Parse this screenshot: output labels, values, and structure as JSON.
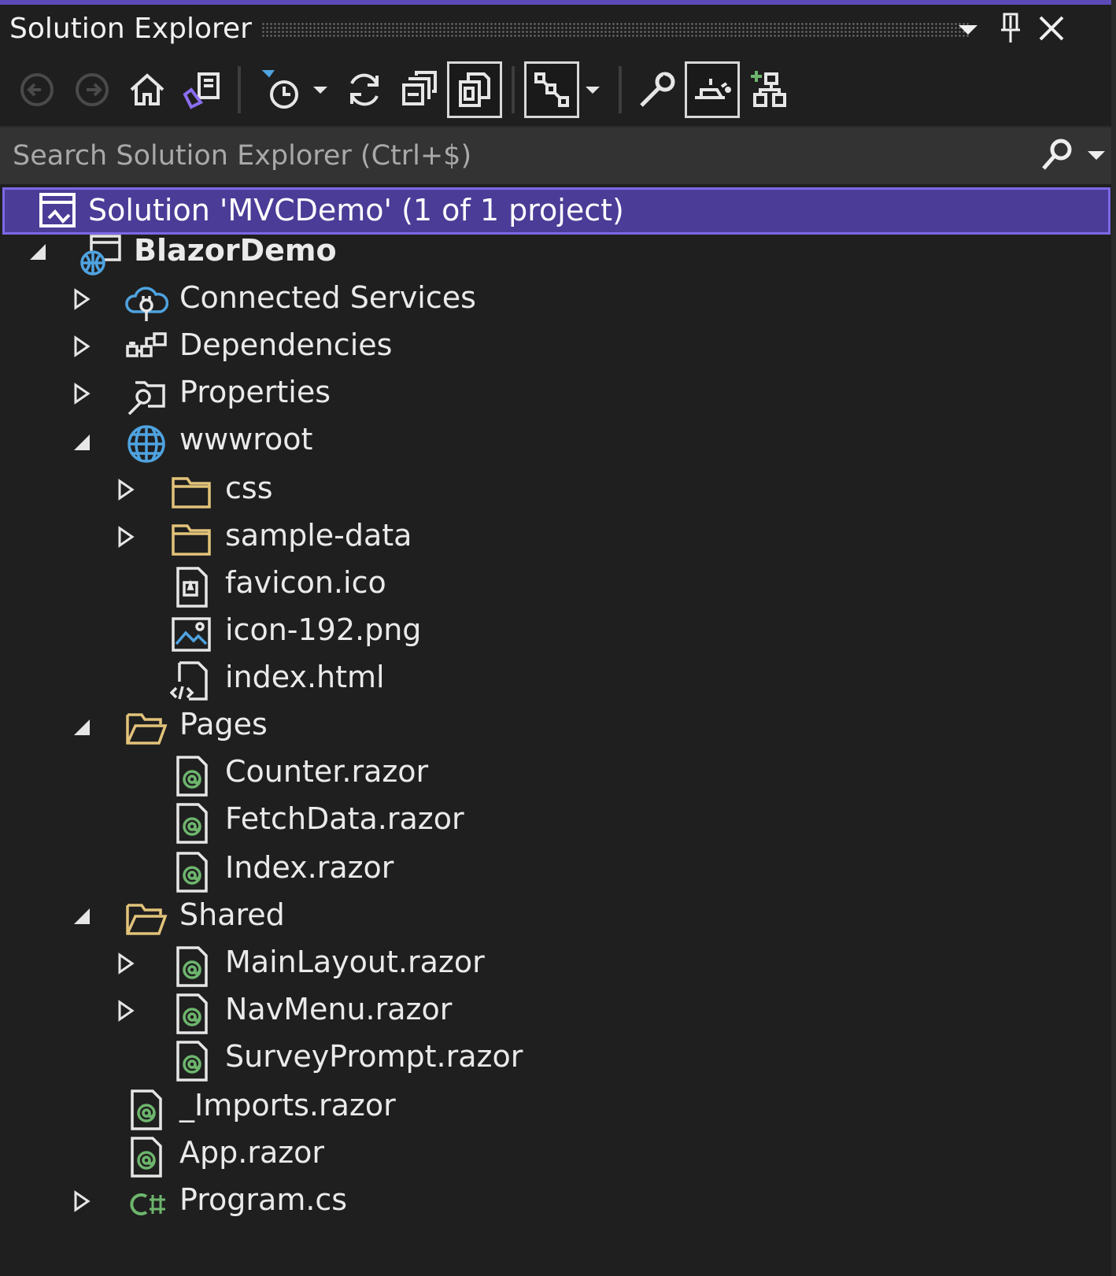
{
  "window": {
    "title": "Solution Explorer"
  },
  "search": {
    "placeholder": "Search Solution Explorer (Ctrl+$)"
  },
  "colors": {
    "background": "#1f1f1f",
    "selection": "#4b3c97",
    "selection_border": "#7b69e6",
    "accent_top": "#5b4ab8",
    "razor_green": "#6db56d",
    "folder": "#e2c37a",
    "web_blue": "#4fa3e0"
  },
  "toolbar": {
    "buttons": [
      "back-icon",
      "forward-icon",
      "home-icon",
      "switch-views-icon",
      "pending-changes-filter-icon",
      "refresh-icon",
      "collapse-all-icon",
      "show-all-files-icon",
      "preview-selected-icon",
      "properties-icon",
      "sync-active-document-icon",
      "new-solution-explorer-view-icon"
    ]
  },
  "tree": {
    "solution": "Solution 'MVCDemo' (1 of 1 project)",
    "project": "BlazorDemo",
    "connected_services": "Connected Services",
    "dependencies": "Dependencies",
    "properties": "Properties",
    "wwwroot": "wwwroot",
    "css": "css",
    "sample_data": "sample-data",
    "favicon": "favicon.ico",
    "icon192": "icon-192.png",
    "index_html": "index.html",
    "pages": "Pages",
    "counter": "Counter.razor",
    "fetchdata": "FetchData.razor",
    "index_razor": "Index.razor",
    "shared": "Shared",
    "mainlayout": "MainLayout.razor",
    "navmenu": "NavMenu.razor",
    "surveyprompt": "SurveyPrompt.razor",
    "imports": "_Imports.razor",
    "app": "App.razor",
    "program": "Program.cs"
  }
}
